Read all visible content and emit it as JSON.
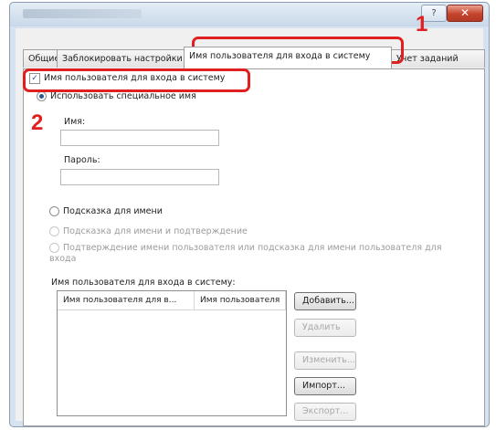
{
  "window": {
    "help_label": "?",
    "close_label": "✕"
  },
  "tabs": [
    {
      "label": "Общие"
    },
    {
      "label": "Заблокировать настройки"
    },
    {
      "label": "Имя пользователя для входа в систему"
    },
    {
      "label": "Учет заданий"
    }
  ],
  "login": {
    "enable_checkbox_label": "Имя пользователя для входа в систему",
    "enable_checked": true,
    "options": {
      "custom_name": "Использовать специальное имя",
      "name_prompt": "Подсказка для имени",
      "name_prompt_confirm": "Подсказка для имени и подтверждение",
      "confirm_or_prompt": "Подтверждение имени пользователя или подсказка для имени пользователя для входа"
    },
    "name_label": "Имя:",
    "name_value": "",
    "password_label": "Пароль:",
    "password_value": "",
    "list_label": "Имя пользователя для входа в систему:",
    "list_columns": [
      "Имя пользователя для в...",
      "Имя пользователя"
    ],
    "buttons": {
      "add": "Добавить...",
      "delete": "Удалить",
      "edit": "Изменить...",
      "import": "Импорт...",
      "export": "Экспорт..."
    }
  },
  "annotations": {
    "step1": "1",
    "step2": "2"
  },
  "colors": {
    "highlight": "#e02020",
    "window_frame": "#d6e2ef",
    "close_button": "#c5432b"
  }
}
